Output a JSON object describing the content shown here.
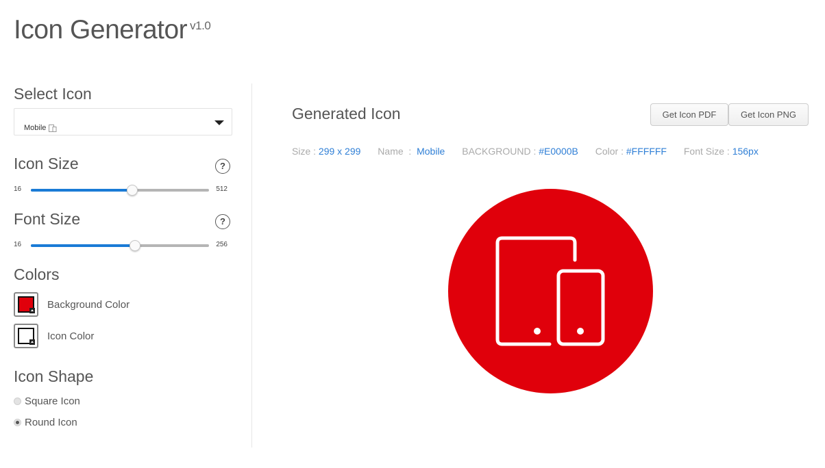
{
  "header": {
    "title": "Icon Generator",
    "version": "v1.0"
  },
  "sidebar": {
    "select_icon": {
      "heading": "Select Icon",
      "value": "Mobile",
      "icon": "mobile-tablet-icon"
    },
    "icon_size": {
      "heading": "Icon Size",
      "help": "?",
      "min": "16",
      "max": "512",
      "value": 299,
      "range": [
        16,
        512
      ]
    },
    "font_size": {
      "heading": "Font Size",
      "help": "?",
      "min": "16",
      "max": "256",
      "value": 156,
      "range": [
        16,
        256
      ]
    },
    "colors": {
      "heading": "Colors",
      "background_label": "Background Color",
      "background_value": "#E0000B",
      "icon_label": "Icon Color",
      "icon_value": "#FFFFFF"
    },
    "shape": {
      "heading": "Icon Shape",
      "options": [
        {
          "label": "Square Icon",
          "checked": false
        },
        {
          "label": "Round Icon",
          "checked": true
        }
      ]
    }
  },
  "main": {
    "title": "Generated Icon",
    "buttons": {
      "pdf": "Get Icon PDF",
      "png": "Get Icon PNG"
    },
    "meta": {
      "size_label": "Size : ",
      "size_value": "299 x 299",
      "name_label": "Name  :  ",
      "name_value": "Mobile",
      "bg_label": "BACKGROUND : ",
      "bg_value": "#E0000B",
      "color_label": "Color : ",
      "color_value": "#FFFFFF",
      "font_label": "Font Size : ",
      "font_value": "156px"
    },
    "preview": {
      "shape": "round",
      "background": "#E0000B",
      "foreground": "#FFFFFF",
      "icon": "mobile-tablet-icon"
    }
  },
  "theme": {
    "accent": "#1a7bd6",
    "link": "#2f7fd6"
  }
}
